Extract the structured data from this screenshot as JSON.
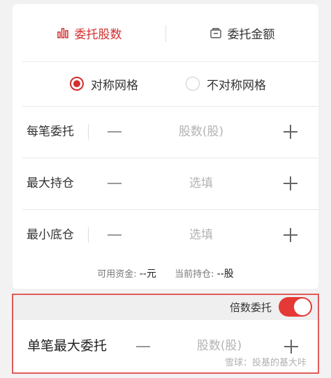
{
  "tabs": [
    {
      "label": "委托股数",
      "icon": "bar-chart-icon",
      "active": true
    },
    {
      "label": "委托金额",
      "icon": "money-box-icon",
      "active": false
    }
  ],
  "grid_type": {
    "options": [
      {
        "label": "对称网格",
        "checked": true
      },
      {
        "label": "不对称网格",
        "checked": false
      }
    ]
  },
  "rows": [
    {
      "label": "每笔委托",
      "placeholder": "股数(股)"
    },
    {
      "label": "最大持仓",
      "placeholder": "选填"
    },
    {
      "label": "最小底仓",
      "placeholder": "选填"
    }
  ],
  "funds": {
    "available_label": "可用资金:",
    "available_value": "--元",
    "position_label": "当前持仓:",
    "position_value": "--股"
  },
  "multiple": {
    "toggle_label": "倍数委托",
    "enabled": true,
    "row_label": "单笔最大委托",
    "placeholder": "股数(股)"
  },
  "watermark": "雪球：投基的基大咔",
  "colors": {
    "accent": "#d32f2f",
    "highlight_border": "#e05a5a",
    "placeholder": "#b3b3b3"
  }
}
